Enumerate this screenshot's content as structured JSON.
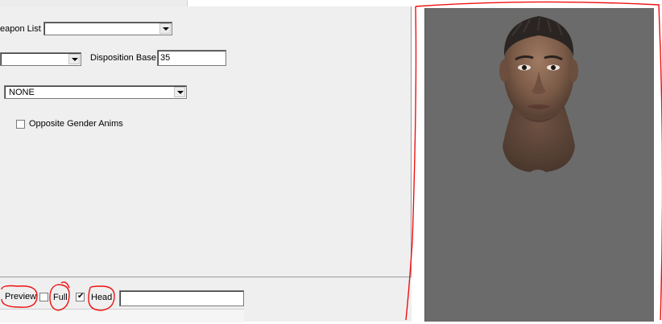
{
  "form": {
    "weapon_list_label": "eapon List",
    "weapon_list_value": "",
    "left_combo_value": "",
    "disposition_label": "Disposition Base",
    "disposition_value": "35",
    "race_combo_value": "NONE",
    "opposite_gender_label": "Opposite Gender Anims",
    "opposite_gender_checked": false
  },
  "preview": {
    "preview_label": "Preview",
    "full_label": "Full",
    "full_checked": false,
    "head_label": "Head",
    "head_checked": true,
    "text_value": ""
  },
  "viewport": {
    "subject": "head-render",
    "background_color": "#6b6b6b"
  },
  "annotation_color": "#e11111"
}
